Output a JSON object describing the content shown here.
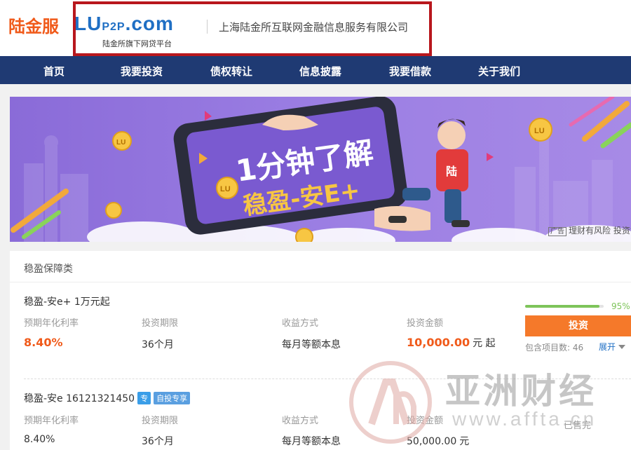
{
  "header": {
    "brand_cn": "陆金服",
    "logo_main": "LU",
    "logo_small": "P2P",
    "logo_domain": ".com",
    "logo_subtitle": "陆金所旗下网贷平台",
    "company_name": "上海陆金所互联网金融信息服务有限公司"
  },
  "nav": {
    "items": [
      "首页",
      "我要投资",
      "债权转让",
      "信息披露",
      "我要借款",
      "关于我们"
    ]
  },
  "banner": {
    "line1": "1分钟了解",
    "line2": "稳盈-安E+",
    "coin_text": "LU",
    "phone_char": "陆",
    "ad_tag": "广告",
    "footer_text": "理财有风险  投资需"
  },
  "section": {
    "title": "稳盈保障类",
    "labels": {
      "rate": "预期年化利率",
      "term": "投资期限",
      "method": "收益方式",
      "amount": "投资金额"
    }
  },
  "products": [
    {
      "name": "稳盈-安e+ 1万元起",
      "rate": "8.40%",
      "term": "36个月",
      "method": "每月等额本息",
      "amount": "10,000.00",
      "unit": "元 起",
      "progress": 95,
      "progress_text": "95%",
      "button": "投资",
      "count": "包含项目数: 46",
      "expand": "展开"
    },
    {
      "name": "稳盈-安e 16121321450",
      "badge1": "专",
      "badge2": "自投专享",
      "rate": "8.40%",
      "term": "36个月",
      "method": "每月等额本息",
      "amount": "50,000.00",
      "unit": "元",
      "status": "已售完"
    }
  ],
  "watermark": {
    "cn": "亚洲财经",
    "url": "www.affta.cn"
  },
  "colors": {
    "brand_orange": "#f05a1a",
    "nav_blue": "#1f3a73",
    "highlight_red": "#b8171d",
    "progress_green": "#7ec45a",
    "button_orange": "#f5792a",
    "banner_purple": "#9b7ee3"
  }
}
